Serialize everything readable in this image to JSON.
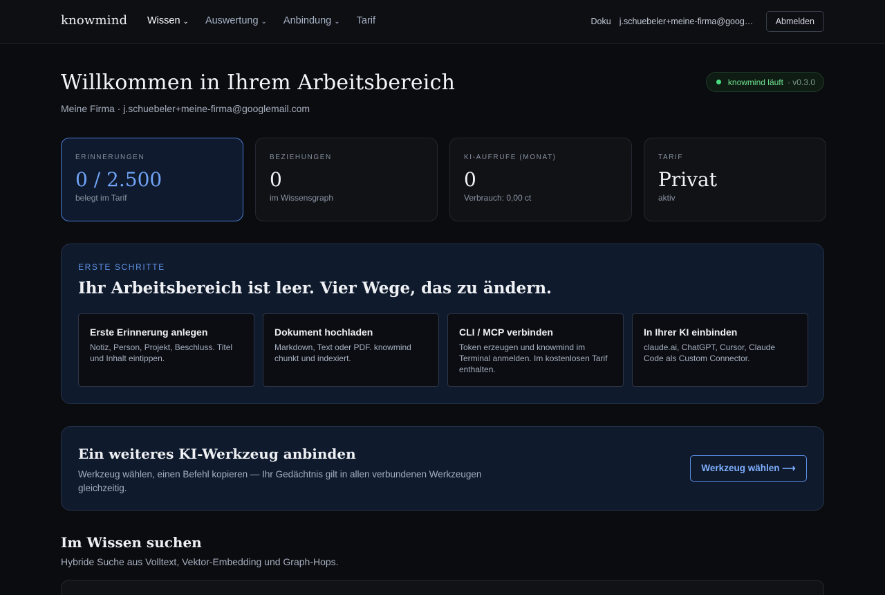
{
  "brand": "knowmind",
  "nav": {
    "items": [
      {
        "label": "Wissen",
        "chevron": true,
        "active": true
      },
      {
        "label": "Auswertung",
        "chevron": true,
        "active": false
      },
      {
        "label": "Anbindung",
        "chevron": true,
        "active": false
      },
      {
        "label": "Tarif",
        "chevron": false,
        "active": false
      }
    ],
    "chevron_icon": "chevron-down-icon"
  },
  "topright": {
    "docs_label": "Doku",
    "email": "j.schuebeler+meine-firma@googlemail.com",
    "logout_label": "Abmelden"
  },
  "header": {
    "title": "Willkommen in Ihrem Arbeitsbereich",
    "subtitle": "Meine Firma · j.schuebeler+meine-firma@googlemail.com",
    "status": {
      "text": "knowmind läuft",
      "version": "· v0.3.0",
      "color": "#4ade80"
    }
  },
  "stats": [
    {
      "label": "ERINNERUNGEN",
      "value": "0 / 2.500",
      "caption": "belegt im Tarif"
    },
    {
      "label": "BEZIEHUNGEN",
      "value": "0",
      "caption": "im Wissensgraph"
    },
    {
      "label": "KI-AUFRUFE (MONAT)",
      "value": "0",
      "caption": "Verbrauch: 0,00 ct"
    },
    {
      "label": "TARIF",
      "value": "Privat",
      "caption": "aktiv"
    }
  ],
  "onboarding": {
    "kicker": "ERSTE SCHRITTE",
    "title": "Ihr Arbeitsbereich ist leer. Vier Wege, das zu ändern.",
    "steps": [
      {
        "title": "Erste Erinnerung anlegen",
        "desc": "Notiz, Person, Projekt, Beschluss. Titel und Inhalt eintippen."
      },
      {
        "title": "Dokument hochladen",
        "desc": "Markdown, Text oder PDF. knowmind chunkt und indexiert."
      },
      {
        "title": "CLI / MCP verbinden",
        "desc": "Token erzeugen und knowmind im Terminal anmelden. Im kostenlosen Tarif enthalten."
      },
      {
        "title": "In Ihrer KI einbinden",
        "desc": "claude.ai, ChatGPT, Cursor, Claude Code als Custom Connector."
      }
    ]
  },
  "connect": {
    "title": "Ein weiteres KI-Werkzeug anbinden",
    "desc": "Werkzeug wählen, einen Befehl kopieren — Ihr Gedächtnis gilt in allen verbundenen Werkzeugen gleichzeitig.",
    "button_label": "Werkzeug wählen ⟶"
  },
  "search": {
    "title": "Im Wissen suchen",
    "subtitle": "Hybride Suche aus Volltext, Vektor-Embedding und Graph-Hops."
  },
  "colors": {
    "accent": "#6fa3f5",
    "background": "#0b0c0f",
    "panel": "#0f1a2d"
  }
}
